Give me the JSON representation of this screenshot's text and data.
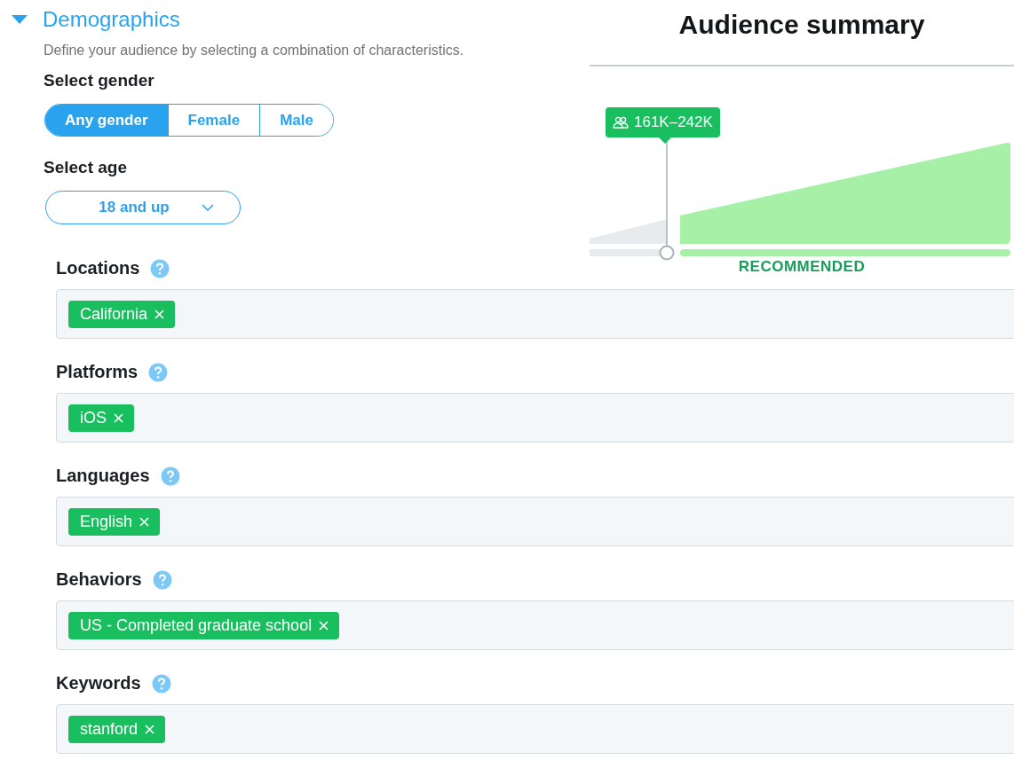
{
  "section": {
    "title": "Demographics",
    "expanded": true,
    "description": "Define your audience by selecting a combination of characteristics."
  },
  "gender": {
    "label": "Select gender",
    "options": [
      {
        "label": "Any gender",
        "selected": true
      },
      {
        "label": "Female",
        "selected": false
      },
      {
        "label": "Male",
        "selected": false
      }
    ]
  },
  "age": {
    "label": "Select age",
    "value": "18 and up"
  },
  "audience_summary": {
    "title": "Audience summary",
    "estimate": "161K–242K",
    "zone_label": "RECOMMENDED"
  },
  "fields": [
    {
      "label": "Locations",
      "tags": [
        "California"
      ]
    },
    {
      "label": "Platforms",
      "tags": [
        "iOS"
      ]
    },
    {
      "label": "Languages",
      "tags": [
        "English"
      ]
    },
    {
      "label": "Behaviors",
      "tags": [
        "US - Completed graduate school"
      ]
    },
    {
      "label": "Keywords",
      "tags": [
        "stanford"
      ]
    }
  ]
}
